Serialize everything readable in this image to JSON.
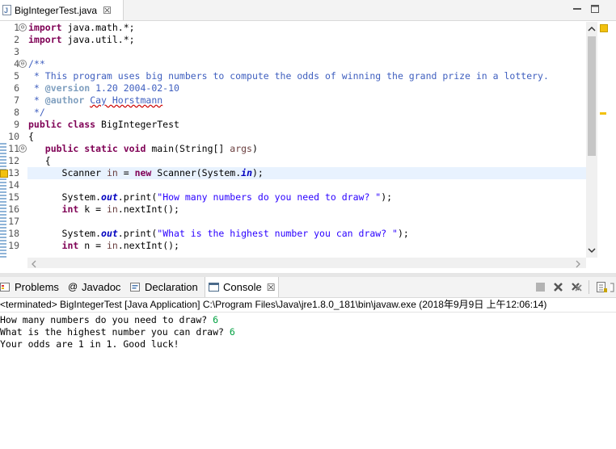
{
  "editor": {
    "tab_label": "BigIntegerTest.java",
    "close_glyph": "☒",
    "lines": [
      {
        "num": "1",
        "fold": "⊖"
      },
      {
        "num": "2"
      },
      {
        "num": "3"
      },
      {
        "num": "4",
        "fold": "⊖"
      },
      {
        "num": "5"
      },
      {
        "num": "6"
      },
      {
        "num": "7"
      },
      {
        "num": "8"
      },
      {
        "num": "9"
      },
      {
        "num": "10"
      },
      {
        "num": "11",
        "fold": "⊖"
      },
      {
        "num": "12"
      },
      {
        "num": "13"
      },
      {
        "num": "14"
      },
      {
        "num": "15"
      },
      {
        "num": "16"
      },
      {
        "num": "17"
      },
      {
        "num": "18"
      },
      {
        "num": "19"
      }
    ],
    "code": {
      "l1_kw": "import",
      "l1_rest": " java.math.*;",
      "l2_kw": "import",
      "l2_rest": " java.util.*;",
      "l4": "/**",
      "l5": " * This program uses big numbers to compute the odds of winning the grand prize in a lottery.",
      "l6_pre": " * ",
      "l6_tag": "@version",
      "l6_rest": " 1.20 2004-02-10",
      "l7_pre": " * ",
      "l7_tag": "@author",
      "l7_sp": " ",
      "l7_name": "Cay Horstmann",
      "l8": " */",
      "l9_kw": "public class",
      "l9_rest": " BigIntegerTest",
      "l10": "{",
      "l11_ind": "   ",
      "l11_kw": "public static void",
      "l11_mid": " main(String[] ",
      "l11_arg": "args",
      "l11_end": ")",
      "l12": "   {",
      "l13_ind": "      Scanner ",
      "l13_var": "in",
      "l13_eq": " = ",
      "l13_kw": "new",
      "l13_mid": " Scanner(System.",
      "l13_fld": "in",
      "l13_end": ");",
      "l15_ind": "      System.",
      "l15_fld": "out",
      "l15_mid": ".print(",
      "l15_str": "\"How many numbers do you need to draw? \"",
      "l15_end": ");",
      "l16_ind": "      ",
      "l16_kw": "int",
      "l16_mid": " k = ",
      "l16_var": "in",
      "l16_end": ".nextInt();",
      "l18_ind": "      System.",
      "l18_fld": "out",
      "l18_mid": ".print(",
      "l18_str": "\"What is the highest number you can draw? \"",
      "l18_end": ");",
      "l19_ind": "      ",
      "l19_kw": "int",
      "l19_mid": " n = ",
      "l19_var": "in",
      "l19_end": ".nextInt();"
    }
  },
  "views": {
    "tabs": [
      {
        "label": "Problems"
      },
      {
        "label": "Javadoc"
      },
      {
        "label": "Declaration"
      },
      {
        "label": "Console"
      }
    ],
    "console_close": "☒"
  },
  "console": {
    "status": "<terminated> BigIntegerTest [Java Application] C:\\Program Files\\Java\\jre1.8.0_181\\bin\\javaw.exe (2018年9月9日 上午12:06:14)",
    "lines": [
      {
        "text": "How many numbers do you need to draw? ",
        "input": "6"
      },
      {
        "text": "What is the highest number you can draw? ",
        "input": "6"
      },
      {
        "text": "Your odds are 1 in 1. Good luck!",
        "input": ""
      }
    ]
  },
  "colors": {
    "keyword": "#7f0055",
    "comment": "#3f5fbf",
    "string": "#2a00ff",
    "field": "#0000c0",
    "console_input": "#00a040"
  }
}
